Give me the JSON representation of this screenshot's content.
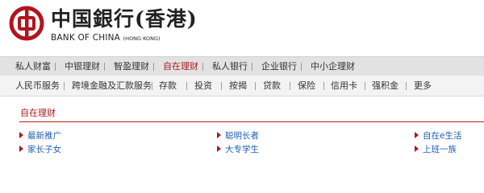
{
  "brand": {
    "name_cn": "中国銀行(香港)",
    "name_en": "BANK OF CHINA",
    "name_en_sub": "(HONG KONG)"
  },
  "nav_primary": {
    "items": [
      {
        "label": "私人财富"
      },
      {
        "label": "中银理财"
      },
      {
        "label": "智盈理财"
      },
      {
        "label": "自在理财",
        "active": true
      },
      {
        "label": "私人银行"
      },
      {
        "label": "企业银行"
      },
      {
        "label": "中小企理财"
      }
    ]
  },
  "nav_secondary": {
    "items": [
      {
        "label": "人民币服务"
      },
      {
        "label": "跨境金融及汇款服务"
      },
      {
        "label": "存款"
      },
      {
        "label": "投资"
      },
      {
        "label": "按揭"
      },
      {
        "label": "贷款"
      },
      {
        "label": "保险"
      },
      {
        "label": "信用卡"
      },
      {
        "label": "强积金"
      },
      {
        "label": "更多"
      }
    ]
  },
  "section": {
    "title": "自在理财",
    "links": [
      {
        "label": "最新推广"
      },
      {
        "label": "聪明长者"
      },
      {
        "label": "自在e生活"
      },
      {
        "label": "家长子女"
      },
      {
        "label": "大专学生"
      },
      {
        "label": "上班一族"
      }
    ]
  },
  "colors": {
    "accent": "#b0161e",
    "link": "#1f5fb3",
    "nav_primary_bg": "#e2e2e2",
    "nav_secondary_bg": "#f3f3f3"
  }
}
